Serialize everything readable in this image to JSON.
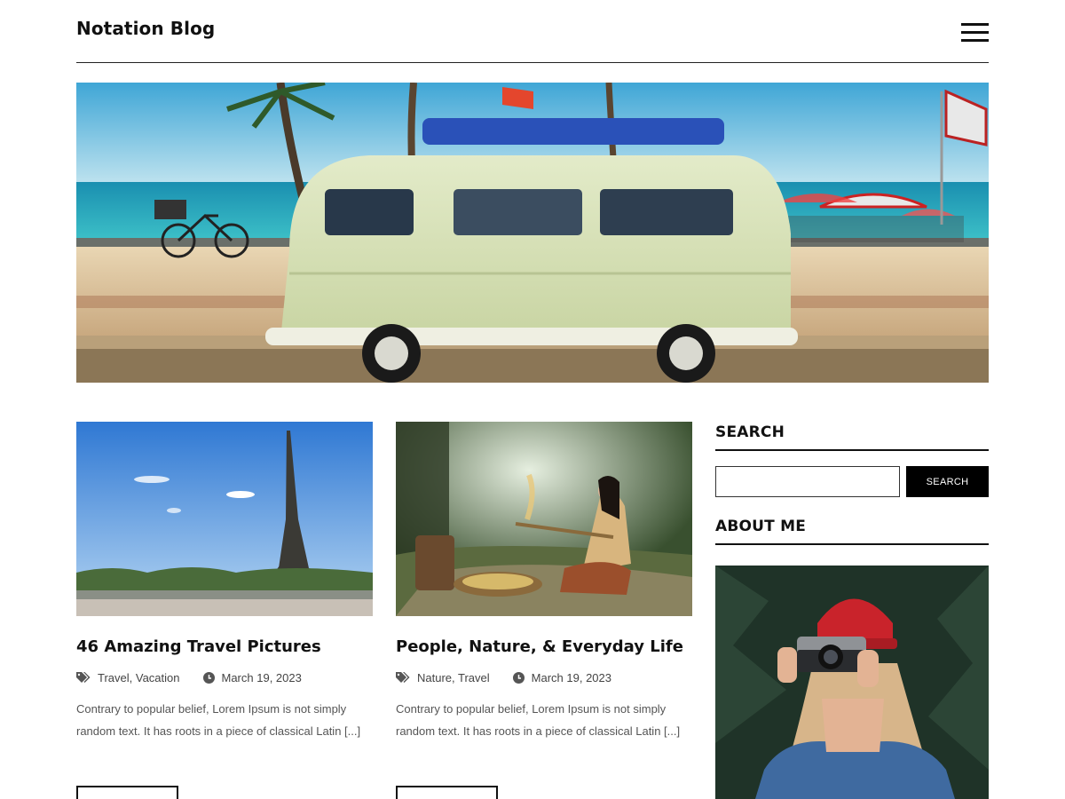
{
  "header": {
    "site_title": "Notation Blog"
  },
  "posts": [
    {
      "title": "46 Amazing Travel Pictures",
      "categories": "Travel, Vacation",
      "date": "March 19, 2023",
      "excerpt": "Contrary to popular belief, Lorem Ipsum is not simply random text. It has roots in a piece of classical Latin [...]",
      "image_icon": "eiffel-tower-photo"
    },
    {
      "title": "People, Nature, & Everyday Life",
      "categories": "Nature, Travel",
      "date": "March 19, 2023",
      "excerpt": "Contrary to popular belief, Lorem Ipsum is not simply random text. It has roots in a piece of classical Latin [...]",
      "image_icon": "woman-winnowing-photo"
    }
  ],
  "sidebar": {
    "search_title": "SEARCH",
    "search_button": "SEARCH",
    "search_placeholder": "",
    "about_title": "ABOUT ME"
  },
  "colors": {
    "text": "#111111",
    "meta": "#444444",
    "button_bg": "#000000"
  }
}
